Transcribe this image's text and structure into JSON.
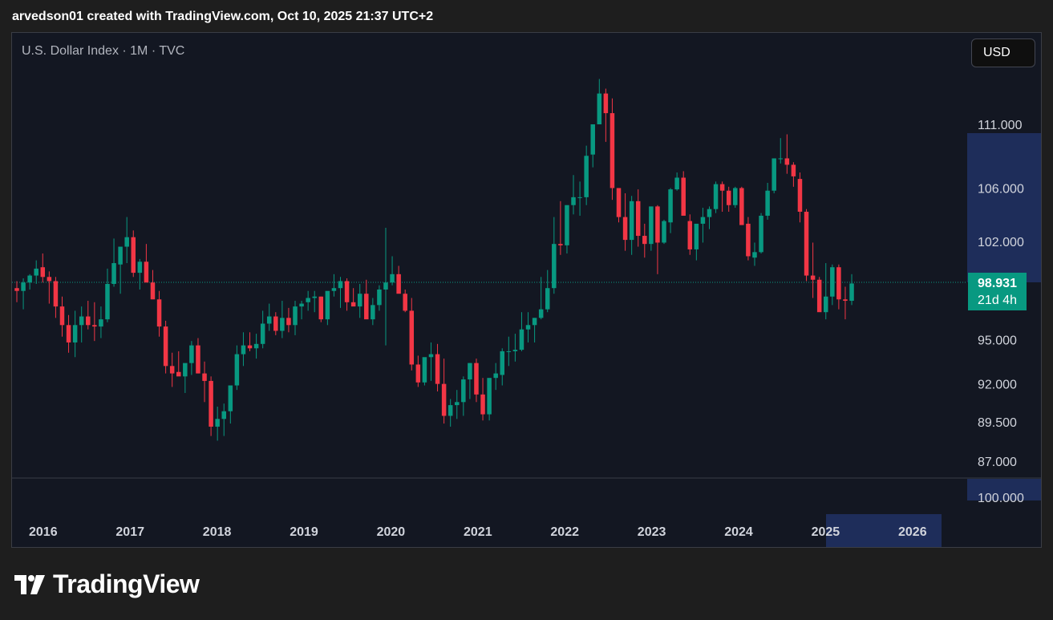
{
  "header": {
    "caption": "arvedson01 created with TradingView.com, Oct 10, 2025 21:37 UTC+2"
  },
  "chart_header": {
    "symbol_line": "U.S. Dollar Index · 1M · TVC"
  },
  "currency_button": {
    "label": "USD"
  },
  "price_tag": {
    "price": "98.931",
    "countdown": "21d 4h"
  },
  "volume_axis_label": "100.000",
  "branding": {
    "logo_text": "TradingView"
  },
  "colors": {
    "up": "#089981",
    "down": "#f23645",
    "background": "#131722",
    "axis_highlight": "#1e2d5a"
  },
  "chart_data": {
    "type": "candlestick",
    "title": "U.S. Dollar Index · 1M · TVC",
    "interval": "1M",
    "y_ticks": [
      "111.000",
      "106.000",
      "102.000",
      "95.000",
      "92.000",
      "89.500",
      "87.000"
    ],
    "y_tick_values": [
      111,
      106,
      102,
      95,
      92,
      89.5,
      87
    ],
    "x_ticks": [
      "2016",
      "2017",
      "2018",
      "2019",
      "2020",
      "2021",
      "2022",
      "2023",
      "2024",
      "2025",
      "2026"
    ],
    "last_price": 98.931,
    "scale": "log",
    "candles": [
      [
        98.6,
        99.1,
        97.6,
        98.4
      ],
      [
        98.4,
        99.3,
        97.1,
        99.0
      ],
      [
        99.0,
        99.6,
        98.5,
        99.5
      ],
      [
        99.5,
        100.6,
        98.9,
        100.0
      ],
      [
        100.1,
        101.1,
        99.0,
        99.4
      ],
      [
        99.4,
        99.8,
        97.5,
        99.1
      ],
      [
        99.1,
        99.4,
        96.5,
        97.3
      ],
      [
        97.3,
        98.0,
        95.2,
        96.0
      ],
      [
        96.0,
        96.7,
        94.1,
        94.8
      ],
      [
        94.8,
        97.0,
        93.8,
        96.0
      ],
      [
        96.0,
        97.3,
        94.8,
        96.6
      ],
      [
        96.6,
        97.7,
        95.7,
        96.0
      ],
      [
        96.0,
        97.6,
        94.9,
        95.9
      ],
      [
        95.9,
        97.3,
        95.1,
        96.4
      ],
      [
        96.4,
        100.0,
        96.2,
        98.9
      ],
      [
        98.9,
        102.2,
        98.7,
        100.4
      ],
      [
        100.3,
        101.5,
        98.2,
        101.6
      ],
      [
        101.6,
        103.8,
        100.4,
        102.3
      ],
      [
        102.3,
        102.8,
        99.4,
        99.7
      ],
      [
        99.7,
        100.7,
        98.5,
        100.5
      ],
      [
        100.5,
        101.8,
        99.1,
        99.0
      ],
      [
        99.0,
        99.9,
        97.9,
        97.8
      ],
      [
        97.8,
        98.4,
        95.2,
        95.9
      ],
      [
        95.9,
        96.3,
        92.7,
        93.2
      ],
      [
        93.2,
        94.1,
        91.8,
        92.7
      ],
      [
        92.8,
        94.2,
        92.6,
        92.5
      ],
      [
        92.5,
        93.3,
        91.4,
        93.4
      ],
      [
        93.4,
        94.9,
        92.6,
        94.6
      ],
      [
        94.6,
        95.1,
        92.7,
        92.7
      ],
      [
        92.7,
        93.5,
        90.8,
        92.2
      ],
      [
        92.2,
        92.5,
        88.6,
        89.2
      ],
      [
        89.2,
        90.5,
        88.3,
        89.7
      ],
      [
        89.7,
        90.7,
        88.6,
        90.2
      ],
      [
        90.2,
        91.2,
        89.4,
        91.9
      ],
      [
        91.9,
        94.6,
        91.6,
        94.0
      ],
      [
        94.0,
        95.5,
        93.2,
        94.6
      ],
      [
        94.6,
        95.5,
        94.2,
        94.4
      ],
      [
        94.4,
        95.4,
        93.7,
        94.7
      ],
      [
        94.7,
        97.0,
        94.4,
        96.1
      ],
      [
        96.1,
        97.5,
        95.6,
        96.6
      ],
      [
        96.6,
        96.9,
        95.3,
        95.6
      ],
      [
        95.6,
        97.7,
        95.1,
        96.5
      ],
      [
        96.5,
        97.2,
        95.5,
        96.0
      ],
      [
        96.0,
        97.7,
        95.3,
        97.3
      ],
      [
        97.3,
        97.7,
        96.4,
        97.5
      ],
      [
        97.6,
        98.4,
        97.0,
        97.9
      ],
      [
        97.9,
        98.4,
        96.9,
        98.0
      ],
      [
        98.0,
        98.0,
        96.2,
        96.4
      ],
      [
        96.4,
        98.0,
        96.0,
        98.4
      ],
      [
        98.4,
        99.6,
        98.0,
        98.6
      ],
      [
        98.6,
        99.4,
        97.2,
        99.1
      ],
      [
        99.1,
        99.3,
        97.0,
        97.6
      ],
      [
        97.6,
        98.6,
        97.4,
        97.3
      ],
      [
        97.3,
        98.9,
        96.5,
        98.2
      ],
      [
        98.2,
        99.2,
        97.5,
        96.4
      ],
      [
        96.4,
        97.9,
        96.0,
        97.4
      ],
      [
        97.4,
        98.8,
        97.0,
        98.5
      ],
      [
        98.5,
        103.0,
        94.6,
        99.0
      ],
      [
        99.0,
        100.9,
        98.8,
        99.6
      ],
      [
        99.6,
        100.2,
        98.3,
        98.2
      ],
      [
        98.2,
        98.5,
        96.9,
        97.0
      ],
      [
        97.0,
        97.9,
        92.9,
        93.3
      ],
      [
        93.3,
        93.9,
        91.8,
        92.1
      ],
      [
        92.1,
        93.7,
        91.9,
        93.8
      ],
      [
        93.8,
        94.8,
        92.2,
        94.0
      ],
      [
        94.0,
        94.7,
        91.5,
        92.0
      ],
      [
        92.0,
        93.7,
        89.4,
        89.9
      ],
      [
        89.9,
        91.0,
        89.2,
        90.6
      ],
      [
        90.6,
        91.6,
        89.7,
        90.8
      ],
      [
        90.8,
        92.5,
        89.9,
        92.3
      ],
      [
        92.3,
        93.4,
        91.0,
        93.4
      ],
      [
        93.4,
        93.7,
        90.8,
        91.3
      ],
      [
        91.3,
        92.4,
        89.6,
        90.0
      ],
      [
        90.0,
        92.2,
        89.6,
        92.4
      ],
      [
        92.4,
        93.4,
        91.6,
        92.7
      ],
      [
        92.6,
        94.4,
        91.9,
        94.2
      ],
      [
        94.2,
        95.2,
        93.2,
        94.2
      ],
      [
        94.2,
        95.4,
        93.5,
        94.3
      ],
      [
        94.3,
        96.9,
        94.2,
        95.7
      ],
      [
        95.7,
        96.9,
        94.8,
        96.0
      ],
      [
        96.0,
        96.5,
        94.8,
        96.5
      ],
      [
        96.5,
        99.4,
        96.4,
        97.1
      ],
      [
        97.1,
        99.9,
        96.9,
        98.6
      ],
      [
        98.6,
        103.8,
        98.2,
        101.8
      ],
      [
        101.8,
        105.0,
        101.0,
        101.7
      ],
      [
        101.7,
        104.6,
        101.1,
        104.7
      ],
      [
        104.7,
        107.0,
        104.0,
        105.3
      ],
      [
        105.3,
        106.5,
        103.9,
        105.3
      ],
      [
        105.3,
        109.3,
        104.7,
        108.5
      ],
      [
        108.6,
        110.9,
        107.6,
        111.0
      ],
      [
        111.0,
        114.7,
        111.0,
        113.5
      ],
      [
        113.5,
        113.9,
        109.6,
        111.9
      ],
      [
        111.9,
        113.1,
        105.1,
        106.0
      ],
      [
        106.0,
        106.0,
        103.4,
        103.8
      ],
      [
        103.8,
        105.6,
        101.3,
        102.1
      ],
      [
        102.1,
        105.4,
        101.0,
        105.0
      ],
      [
        105.0,
        105.9,
        101.6,
        102.4
      ],
      [
        102.4,
        103.3,
        100.8,
        101.8
      ],
      [
        101.8,
        104.4,
        101.3,
        104.6
      ],
      [
        104.6,
        104.7,
        99.6,
        101.9
      ],
      [
        101.9,
        103.6,
        101.8,
        103.5
      ],
      [
        103.4,
        106.0,
        102.6,
        105.9
      ],
      [
        105.9,
        107.2,
        105.8,
        106.8
      ],
      [
        106.8,
        107.3,
        104.3,
        103.9
      ],
      [
        103.5,
        104.0,
        101.0,
        101.4
      ],
      [
        101.4,
        102.7,
        100.6,
        103.3
      ],
      [
        103.3,
        104.5,
        101.9,
        103.8
      ],
      [
        103.8,
        104.6,
        102.9,
        104.4
      ],
      [
        104.4,
        106.5,
        104.1,
        106.3
      ],
      [
        106.3,
        106.5,
        104.2,
        105.8
      ],
      [
        105.8,
        106.1,
        104.2,
        104.7
      ],
      [
        104.7,
        106.1,
        104.5,
        106.0
      ],
      [
        106.0,
        106.1,
        103.9,
        103.2
      ],
      [
        103.3,
        103.8,
        100.6,
        100.9
      ],
      [
        100.8,
        101.9,
        100.2,
        101.2
      ],
      [
        101.2,
        104.1,
        101.1,
        103.9
      ],
      [
        103.9,
        106.4,
        103.6,
        105.8
      ],
      [
        105.8,
        108.3,
        105.6,
        108.3
      ],
      [
        108.3,
        109.9,
        107.9,
        108.3
      ],
      [
        108.3,
        110.2,
        107.1,
        107.8
      ],
      [
        107.8,
        108.0,
        106.1,
        106.9
      ],
      [
        106.7,
        107.2,
        103.4,
        104.2
      ],
      [
        104.2,
        104.4,
        99.1,
        99.5
      ],
      [
        99.5,
        101.9,
        97.9,
        99.2
      ],
      [
        99.2,
        99.4,
        97.6,
        96.9
      ],
      [
        96.9,
        100.4,
        96.4,
        98.0
      ],
      [
        98.0,
        100.3,
        97.4,
        100.1
      ],
      [
        100.1,
        100.3,
        97.1,
        97.8
      ],
      [
        97.8,
        98.7,
        96.4,
        97.7
      ],
      [
        97.7,
        99.6,
        97.4,
        98.931
      ]
    ]
  }
}
